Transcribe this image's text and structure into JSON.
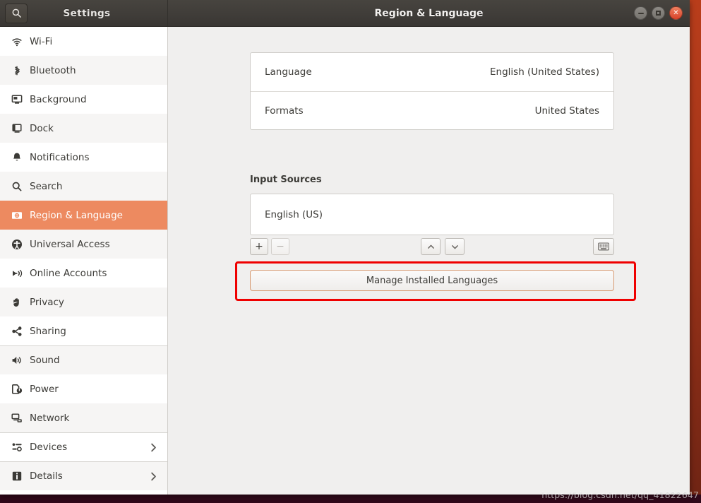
{
  "window": {
    "settings_label": "Settings",
    "title": "Region & Language",
    "search_icon": "search-icon",
    "controls": {
      "minimize": "minimize-button",
      "maximize": "maximize-button",
      "close": "close-button"
    }
  },
  "sidebar": {
    "items": [
      {
        "label": "Wi-Fi",
        "icon": "wifi-icon",
        "selected": false,
        "chevron": false,
        "separator_above": false
      },
      {
        "label": "Bluetooth",
        "icon": "bluetooth-icon",
        "selected": false,
        "chevron": false,
        "separator_above": false
      },
      {
        "label": "Background",
        "icon": "background-icon",
        "selected": false,
        "chevron": false,
        "separator_above": false
      },
      {
        "label": "Dock",
        "icon": "dock-icon",
        "selected": false,
        "chevron": false,
        "separator_above": false
      },
      {
        "label": "Notifications",
        "icon": "bell-icon",
        "selected": false,
        "chevron": false,
        "separator_above": false
      },
      {
        "label": "Search",
        "icon": "search-icon",
        "selected": false,
        "chevron": false,
        "separator_above": false
      },
      {
        "label": "Region & Language",
        "icon": "region-language-icon",
        "selected": true,
        "chevron": false,
        "separator_above": false
      },
      {
        "label": "Universal Access",
        "icon": "accessibility-icon",
        "selected": false,
        "chevron": false,
        "separator_above": false
      },
      {
        "label": "Online Accounts",
        "icon": "online-accounts-icon",
        "selected": false,
        "chevron": false,
        "separator_above": false
      },
      {
        "label": "Privacy",
        "icon": "hand-icon",
        "selected": false,
        "chevron": false,
        "separator_above": false
      },
      {
        "label": "Sharing",
        "icon": "share-icon",
        "selected": false,
        "chevron": false,
        "separator_above": false
      },
      {
        "label": "Sound",
        "icon": "speaker-icon",
        "selected": false,
        "chevron": false,
        "separator_above": true
      },
      {
        "label": "Power",
        "icon": "power-icon",
        "selected": false,
        "chevron": false,
        "separator_above": false
      },
      {
        "label": "Network",
        "icon": "network-icon",
        "selected": false,
        "chevron": false,
        "separator_above": false
      },
      {
        "label": "Devices",
        "icon": "devices-icon",
        "selected": false,
        "chevron": true,
        "separator_above": true
      },
      {
        "label": "Details",
        "icon": "info-icon",
        "selected": false,
        "chevron": true,
        "separator_above": true
      }
    ]
  },
  "main": {
    "language_card": {
      "rows": [
        {
          "label": "Language",
          "value": "English (United States)"
        },
        {
          "label": "Formats",
          "value": "United States"
        }
      ]
    },
    "input_sources": {
      "section_title": "Input Sources",
      "sources": [
        "English (US)"
      ],
      "toolbar": {
        "add_label": "+",
        "remove_label": "−",
        "move_up_label": "⌃",
        "move_down_label": "⌄",
        "keyboard_label": "keyboard-icon"
      }
    },
    "manage_button_label": "Manage Installed Languages"
  },
  "annotation": {
    "highlight_color": "#ef0000"
  },
  "watermark": {
    "text": "https://blog.csdn.net/qq_41822647"
  },
  "theme": {
    "accent": "#ED8A60",
    "titlebar": "#403d39",
    "content_bg": "#f0efee"
  }
}
